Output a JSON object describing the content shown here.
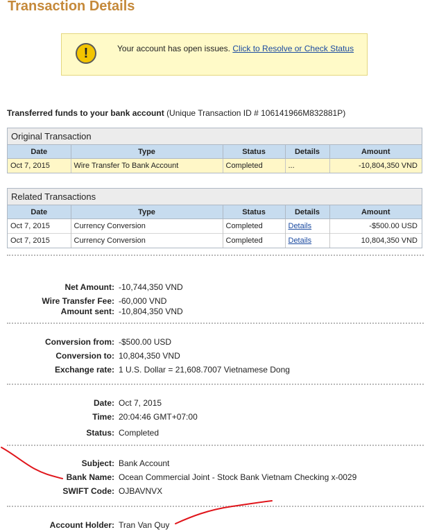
{
  "title": "Transaction Details",
  "alert": {
    "message": "Your account has open issues.",
    "link": "Click to Resolve or Check Status",
    "icon": "!"
  },
  "intro": {
    "bold": "Transferred funds to your bank account",
    "rest": "(Unique Transaction ID # 106141966M832881P)"
  },
  "original": {
    "caption": "Original Transaction",
    "headers": [
      "Date",
      "Type",
      "Status",
      "Details",
      "Amount"
    ],
    "row": {
      "date": "Oct 7, 2015",
      "type": "Wire Transfer To Bank Account",
      "status": "Completed",
      "details": "...",
      "amount": "-10,804,350 VND"
    }
  },
  "related": {
    "caption": "Related Transactions",
    "headers": [
      "Date",
      "Type",
      "Status",
      "Details",
      "Amount"
    ],
    "rows": [
      {
        "date": "Oct 7, 2015",
        "type": "Currency Conversion",
        "status": "Completed",
        "details": "Details",
        "amount": "-$500.00 USD"
      },
      {
        "date": "Oct 7, 2015",
        "type": "Currency Conversion",
        "status": "Completed",
        "details": "Details",
        "amount": "10,804,350 VND"
      }
    ]
  },
  "fields": {
    "net_amount": {
      "label": "Net Amount:",
      "value": "-10,744,350 VND"
    },
    "wire_fee": {
      "label": "Wire Transfer Fee:",
      "value": "-60,000 VND"
    },
    "amount_sent": {
      "label": "Amount sent:",
      "value": "-10,804,350 VND"
    },
    "conv_from": {
      "label": "Conversion from:",
      "value": "-$500.00 USD"
    },
    "conv_to": {
      "label": "Conversion to:",
      "value": "10,804,350 VND"
    },
    "exchange_rate": {
      "label": "Exchange rate:",
      "value": "1 U.S. Dollar = 21,608.7007 Vietnamese Dong"
    },
    "date": {
      "label": "Date:",
      "value": "Oct 7, 2015"
    },
    "time": {
      "label": "Time:",
      "value": "20:04:46 GMT+07:00"
    },
    "status": {
      "label": "Status:",
      "value": "Completed"
    },
    "subject": {
      "label": "Subject:",
      "value": "Bank Account"
    },
    "bank_name": {
      "label": "Bank Name:",
      "value": "Ocean Commercial Joint - Stock Bank Vietnam Checking x-0029"
    },
    "swift": {
      "label": "SWIFT Code:",
      "value": "OJBAVNVX"
    },
    "holder": {
      "label": "Account Holder:",
      "value": "Tran Van Quy"
    }
  },
  "colors": {
    "title": "#c5893a",
    "alert_bg": "#fffac8",
    "header_bg": "#c7dcef",
    "link": "#1a4aa0",
    "annotation": "#e0151b"
  }
}
